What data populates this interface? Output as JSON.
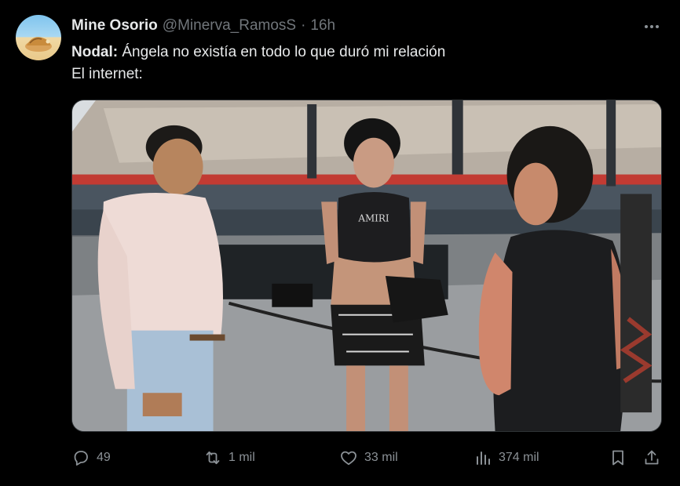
{
  "tweet": {
    "author": {
      "display_name": "Mine Osorio",
      "handle": "@Minerva_RamosS",
      "separator": "·",
      "time": "16h"
    },
    "text": {
      "line1_bold": "Nodal:",
      "line1_rest": " Ángela no existía en todo lo que duró mi relación",
      "line2": "El internet:"
    },
    "media": {
      "shirt_text": "AMIRI"
    },
    "actions": {
      "replies": "49",
      "retweets": "1 mil",
      "likes": "33 mil",
      "views": "374 mil"
    }
  },
  "icons": {
    "more": "more-dots-icon",
    "reply": "reply-icon",
    "retweet": "retweet-icon",
    "like": "heart-icon",
    "views": "views-bars-icon",
    "bookmark": "bookmark-icon",
    "share": "share-icon"
  },
  "colors": {
    "background": "#000000",
    "text": "#e7e9ea",
    "secondary": "#71767b",
    "icon": "#8b9196"
  }
}
